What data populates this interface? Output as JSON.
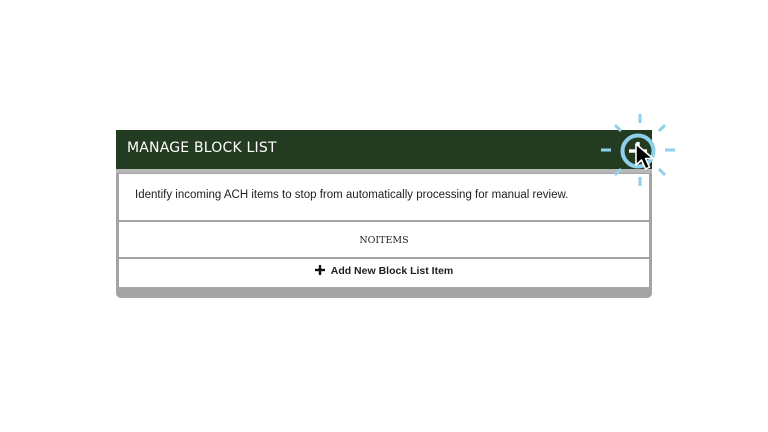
{
  "panel": {
    "title": "MANAGE BLOCK LIST",
    "description": "Identify incoming ACH items to stop from automatically processing for manual review.",
    "empty_text": "NOITEMS",
    "add_label": "Add New Block List Item"
  },
  "icons": {
    "header_add": "plus-circle-icon",
    "row_add": "plus-icon",
    "pointer": "mouse-pointer-icon",
    "highlight": "click-highlight-icon"
  },
  "colors": {
    "header": "#233c21",
    "highlight": "#8fd0ec",
    "panel_border": "#a4a4a4"
  }
}
